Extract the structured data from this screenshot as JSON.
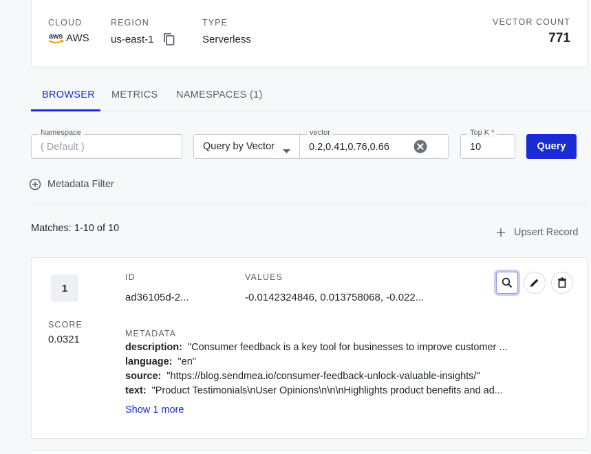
{
  "index_info": {
    "cloud_label": "CLOUD",
    "cloud_value": "AWS",
    "aws_logo_text": "aws",
    "region_label": "REGION",
    "region_value": "us-east-1",
    "type_label": "TYPE",
    "type_value": "Serverless",
    "vector_count_label": "VECTOR COUNT",
    "vector_count_value": "771"
  },
  "tabs": [
    {
      "label": "BROWSER",
      "active": true
    },
    {
      "label": "METRICS",
      "active": false
    },
    {
      "label": "NAMESPACES (1)",
      "active": false
    }
  ],
  "query": {
    "namespace_label": "Namespace",
    "namespace_placeholder": "( Default )",
    "mode_value": "Query by Vector",
    "vector_label": "vector",
    "vector_value": "0.2,0.41,0.76,0.66",
    "topk_label": "Top K *",
    "topk_value": "10",
    "query_button": "Query"
  },
  "metadata_filter_label": "Metadata Filter",
  "matches_text": "Matches: 1-10 of 10",
  "upsert_label": "Upsert Record",
  "results": [
    {
      "rank": "1",
      "score_label": "SCORE",
      "score": "0.0321",
      "id_label": "ID",
      "id": "ad36105d-2...",
      "values_label": "VALUES",
      "values": "-0.0142324846, 0.013758068, -0.022...",
      "metadata_label": "METADATA",
      "metadata": [
        {
          "key": "description:",
          "value": "\"Consumer feedback is a key tool for businesses to improve customer ..."
        },
        {
          "key": "language:",
          "value": "\"en\""
        },
        {
          "key": "source:",
          "value": "\"https://blog.sendmea.io/consumer-feedback-unlock-valuable-insights/\""
        },
        {
          "key": "text:",
          "value": "\"Product Testimonials\\nUser Opinions\\n\\n\\nHighlights product benefits and ad..."
        }
      ],
      "show_more": "Show 1 more"
    }
  ],
  "colors": {
    "accent": "#1a2bd6",
    "background": "#f7f8fa",
    "card": "#ffffff"
  }
}
